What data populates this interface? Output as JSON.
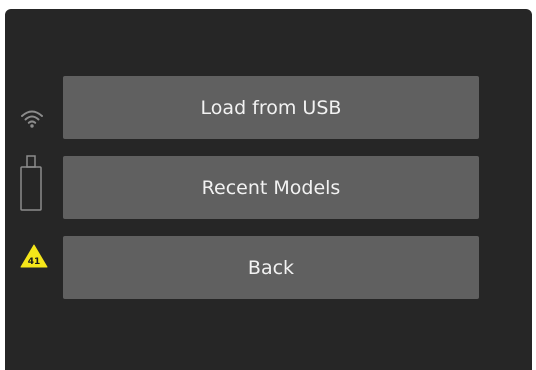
{
  "status": {
    "icons": [
      "wifi-icon",
      "usb-drive-icon",
      "warning-icon"
    ],
    "warning_badge": "41",
    "colors": {
      "icon": "#8c8c8c",
      "warning_fill": "#f5e61a",
      "warning_text": "#1a1a1a"
    }
  },
  "menu": {
    "load_usb_label": "Load from USB",
    "recent_models_label": "Recent Models",
    "back_label": "Back"
  },
  "colors": {
    "screen_bg": "#262626",
    "button_bg": "#606060",
    "button_text": "#f2f2f2"
  }
}
